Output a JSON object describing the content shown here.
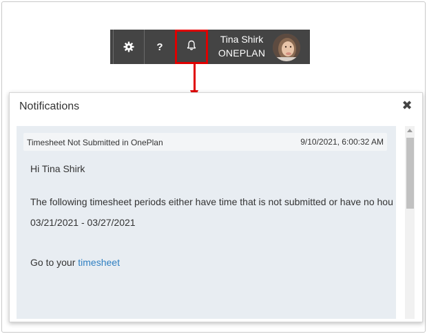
{
  "toolbar": {
    "settings_icon": "gear-icon",
    "help_label": "?",
    "bell_icon": "bell-icon",
    "user_name": "Tina Shirk",
    "user_org": "ONEPLAN"
  },
  "annotation": {
    "highlight_color": "#e00000"
  },
  "notifications_panel": {
    "title": "Notifications",
    "close_icon": "close-icon",
    "items": [
      {
        "subject": "Timesheet Not Submitted in OnePlan",
        "timestamp": "9/10/2021, 6:00:32 AM",
        "greeting": "Hi Tina Shirk",
        "message": "The following timesheet periods either have time that is not submitted or have no hou",
        "period": "03/21/2021 - 03/27/2021",
        "cta_prefix": "Go to your ",
        "cta_link": "timesheet"
      }
    ]
  }
}
